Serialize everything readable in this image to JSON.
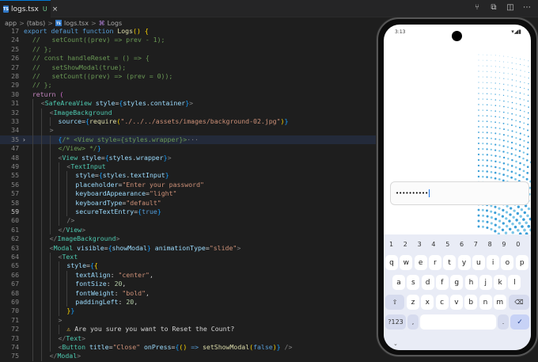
{
  "editor": {
    "tab_filename": "logs.tsx",
    "tab_status": "U",
    "tab_close": "×",
    "ts_icon_text": "TS",
    "top_icons": [
      "branch-icon",
      "split-editor-icon",
      "more-icon"
    ],
    "breadcrumb": [
      "app",
      "(tabs)",
      "logs.tsx",
      "Logs"
    ],
    "breadcrumb_sep": ">",
    "breadcrumb_fn_icon": "⌘"
  },
  "code_lines": [
    {
      "n": "17",
      "indent": 0,
      "seg": [
        [
          "kw",
          "export "
        ],
        [
          "kw",
          "default "
        ],
        [
          "kw",
          "function "
        ],
        [
          "fn",
          "Logs"
        ],
        [
          "br",
          "()"
        ],
        [
          "",
          " "
        ],
        [
          "br",
          "{"
        ]
      ]
    },
    {
      "n": "24",
      "indent": 1,
      "seg": [
        [
          "cm",
          "//   setCount((prev) => prev - 1);"
        ]
      ]
    },
    {
      "n": "25",
      "indent": 1,
      "seg": [
        [
          "cm",
          "// };"
        ]
      ]
    },
    {
      "n": "26",
      "indent": 1,
      "seg": [
        [
          "cm",
          "// const handleReset = () => {"
        ]
      ]
    },
    {
      "n": "27",
      "indent": 1,
      "seg": [
        [
          "cm",
          "//   setShowModal(true);"
        ]
      ]
    },
    {
      "n": "28",
      "indent": 1,
      "seg": [
        [
          "cm",
          "//   setCount((prev) => (prev = 0));"
        ]
      ]
    },
    {
      "n": "29",
      "indent": 1,
      "seg": [
        [
          "cm",
          "// };"
        ]
      ]
    },
    {
      "n": "30",
      "indent": 1,
      "seg": [
        [
          "k2",
          "return "
        ],
        [
          "br2",
          "("
        ]
      ]
    },
    {
      "n": "31",
      "indent": 2,
      "seg": [
        [
          "pun",
          "<"
        ],
        [
          "tag",
          "SafeAreaView "
        ],
        [
          "att",
          "style"
        ],
        [
          "",
          "="
        ],
        [
          "br3",
          "{"
        ],
        [
          "att",
          "styles"
        ],
        [
          "",
          "."
        ],
        [
          "att",
          "container"
        ],
        [
          "br3",
          "}"
        ],
        [
          "pun",
          ">"
        ]
      ]
    },
    {
      "n": "32",
      "indent": 3,
      "seg": [
        [
          "pun",
          "<"
        ],
        [
          "tag",
          "ImageBackground"
        ]
      ]
    },
    {
      "n": "33",
      "indent": 4,
      "seg": [
        [
          "att",
          "source"
        ],
        [
          "",
          "="
        ],
        [
          "br3",
          "{"
        ],
        [
          "fn",
          "require"
        ],
        [
          "br",
          "("
        ],
        [
          "str",
          "\"./../../assets/images/background-02.jpg\""
        ],
        [
          "br",
          ")"
        ],
        [
          "br3",
          "}"
        ]
      ]
    },
    {
      "n": "34",
      "indent": 3,
      "seg": [
        [
          "pun",
          ">"
        ]
      ]
    },
    {
      "n": "35",
      "indent": 4,
      "fold": true,
      "hl": true,
      "seg": [
        [
          "br3",
          "{"
        ],
        [
          "cm",
          "/* <View style={styles.wrapper}>"
        ],
        [
          "pun",
          "···"
        ]
      ]
    },
    {
      "n": "47",
      "indent": 4,
      "seg": [
        [
          "cm",
          "</View> */"
        ],
        [
          "br3",
          "}"
        ]
      ]
    },
    {
      "n": "48",
      "indent": 4,
      "seg": [
        [
          "pun",
          "<"
        ],
        [
          "tag",
          "View "
        ],
        [
          "att",
          "style"
        ],
        [
          "",
          "="
        ],
        [
          "br3",
          "{"
        ],
        [
          "att",
          "styles"
        ],
        [
          "",
          "."
        ],
        [
          "att",
          "wrapper"
        ],
        [
          "br3",
          "}"
        ],
        [
          "pun",
          ">"
        ]
      ]
    },
    {
      "n": "49",
      "indent": 5,
      "seg": [
        [
          "pun",
          "<"
        ],
        [
          "tag",
          "TextInput"
        ]
      ]
    },
    {
      "n": "55",
      "indent": 6,
      "seg": [
        [
          "att",
          "style"
        ],
        [
          "",
          "="
        ],
        [
          "br3",
          "{"
        ],
        [
          "att",
          "styles"
        ],
        [
          "",
          "."
        ],
        [
          "att",
          "textInput"
        ],
        [
          "br3",
          "}"
        ]
      ]
    },
    {
      "n": "56",
      "indent": 6,
      "seg": [
        [
          "att",
          "placeholder"
        ],
        [
          "",
          "="
        ],
        [
          "str",
          "\"Enter your password\""
        ]
      ]
    },
    {
      "n": "57",
      "indent": 6,
      "seg": [
        [
          "att",
          "keyboardAppearance"
        ],
        [
          "",
          "="
        ],
        [
          "str",
          "\"light\""
        ]
      ]
    },
    {
      "n": "58",
      "indent": 6,
      "seg": [
        [
          "att",
          "keyboardType"
        ],
        [
          "",
          "="
        ],
        [
          "str",
          "\"default\""
        ]
      ]
    },
    {
      "n": "59",
      "indent": 6,
      "cur": true,
      "seg": [
        [
          "att",
          "secureTextEntry"
        ],
        [
          "",
          "="
        ],
        [
          "br3",
          "{"
        ],
        [
          "kw",
          "true"
        ],
        [
          "br3",
          "}"
        ]
      ]
    },
    {
      "n": "60",
      "indent": 5,
      "seg": [
        [
          "pun",
          "/>"
        ]
      ]
    },
    {
      "n": "61",
      "indent": 4,
      "seg": [
        [
          "pun",
          "</"
        ],
        [
          "tag",
          "View"
        ],
        [
          "pun",
          ">"
        ]
      ]
    },
    {
      "n": "62",
      "indent": 3,
      "seg": [
        [
          "pun",
          "</"
        ],
        [
          "tag",
          "ImageBackground"
        ],
        [
          "pun",
          ">"
        ]
      ]
    },
    {
      "n": "63",
      "indent": 3,
      "seg": [
        [
          "pun",
          "<"
        ],
        [
          "tag",
          "Modal "
        ],
        [
          "att",
          "visible"
        ],
        [
          "",
          "="
        ],
        [
          "br3",
          "{"
        ],
        [
          "att",
          "showModal"
        ],
        [
          "br3",
          "}"
        ],
        [
          "",
          " "
        ],
        [
          "att",
          "animationType"
        ],
        [
          "",
          "="
        ],
        [
          "str",
          "\"slide\""
        ],
        [
          "pun",
          ">"
        ]
      ]
    },
    {
      "n": "64",
      "indent": 4,
      "seg": [
        [
          "pun",
          "<"
        ],
        [
          "tag",
          "Text"
        ]
      ]
    },
    {
      "n": "65",
      "indent": 5,
      "seg": [
        [
          "att",
          "style"
        ],
        [
          "",
          "="
        ],
        [
          "br3",
          "{"
        ],
        [
          "br",
          "{"
        ]
      ]
    },
    {
      "n": "66",
      "indent": 6,
      "seg": [
        [
          "att",
          "textAlign"
        ],
        [
          "",
          ": "
        ],
        [
          "str",
          "\"center\""
        ],
        [
          "",
          ","
        ]
      ]
    },
    {
      "n": "67",
      "indent": 6,
      "seg": [
        [
          "att",
          "fontSize"
        ],
        [
          "",
          ": "
        ],
        [
          "num",
          "20"
        ],
        [
          "",
          ","
        ]
      ]
    },
    {
      "n": "68",
      "indent": 6,
      "seg": [
        [
          "att",
          "fontWeight"
        ],
        [
          "",
          ": "
        ],
        [
          "str",
          "\"bold\""
        ],
        [
          "",
          ","
        ]
      ]
    },
    {
      "n": "69",
      "indent": 6,
      "seg": [
        [
          "att",
          "paddingLeft"
        ],
        [
          "",
          ": "
        ],
        [
          "num",
          "20"
        ],
        [
          "",
          ","
        ]
      ]
    },
    {
      "n": "70",
      "indent": 5,
      "seg": [
        [
          "br",
          "}"
        ],
        [
          "br3",
          "}"
        ]
      ]
    },
    {
      "n": "71",
      "indent": 4,
      "seg": [
        [
          "pun",
          ">"
        ]
      ]
    },
    {
      "n": "72",
      "indent": 5,
      "seg": [
        [
          "warn",
          "⚠ "
        ],
        [
          "",
          "Are you sure you want to Reset the Count?"
        ]
      ]
    },
    {
      "n": "73",
      "indent": 4,
      "seg": [
        [
          "pun",
          "</"
        ],
        [
          "tag",
          "Text"
        ],
        [
          "pun",
          ">"
        ]
      ]
    },
    {
      "n": "74",
      "indent": 4,
      "seg": [
        [
          "pun",
          "<"
        ],
        [
          "tag",
          "Button "
        ],
        [
          "att",
          "title"
        ],
        [
          "",
          "="
        ],
        [
          "str",
          "\"Close\" "
        ],
        [
          "att",
          "onPress"
        ],
        [
          "",
          "="
        ],
        [
          "br3",
          "{"
        ],
        [
          "br",
          "()"
        ],
        [
          "",
          " "
        ],
        [
          "kw",
          "=> "
        ],
        [
          "fn",
          "setShowModal"
        ],
        [
          "br",
          "("
        ],
        [
          "kw",
          "false"
        ],
        [
          "br",
          ")"
        ],
        [
          "br3",
          "}"
        ],
        [
          "",
          " "
        ],
        [
          "pun",
          "/>"
        ]
      ]
    },
    {
      "n": "75",
      "indent": 3,
      "seg": [
        [
          "pun",
          "</"
        ],
        [
          "tag",
          "Modal"
        ],
        [
          "pun",
          ">"
        ]
      ]
    }
  ],
  "phone": {
    "time": "3:13",
    "status_icons": "▾◢▮",
    "password_value": "••••••••••",
    "keyboard": {
      "numbers": [
        "1",
        "2",
        "3",
        "4",
        "5",
        "6",
        "7",
        "8",
        "9",
        "0"
      ],
      "row1": [
        "q",
        "w",
        "e",
        "r",
        "t",
        "y",
        "u",
        "i",
        "o",
        "p"
      ],
      "row2": [
        "a",
        "s",
        "d",
        "f",
        "g",
        "h",
        "j",
        "k",
        "l"
      ],
      "row3": [
        "z",
        "x",
        "c",
        "v",
        "b",
        "n",
        "m"
      ],
      "shift": "⇧",
      "backspace": "⌫",
      "symbols": "?123",
      "comma": ",",
      "period": ".",
      "enter": "✓",
      "hide": "⌄"
    }
  }
}
